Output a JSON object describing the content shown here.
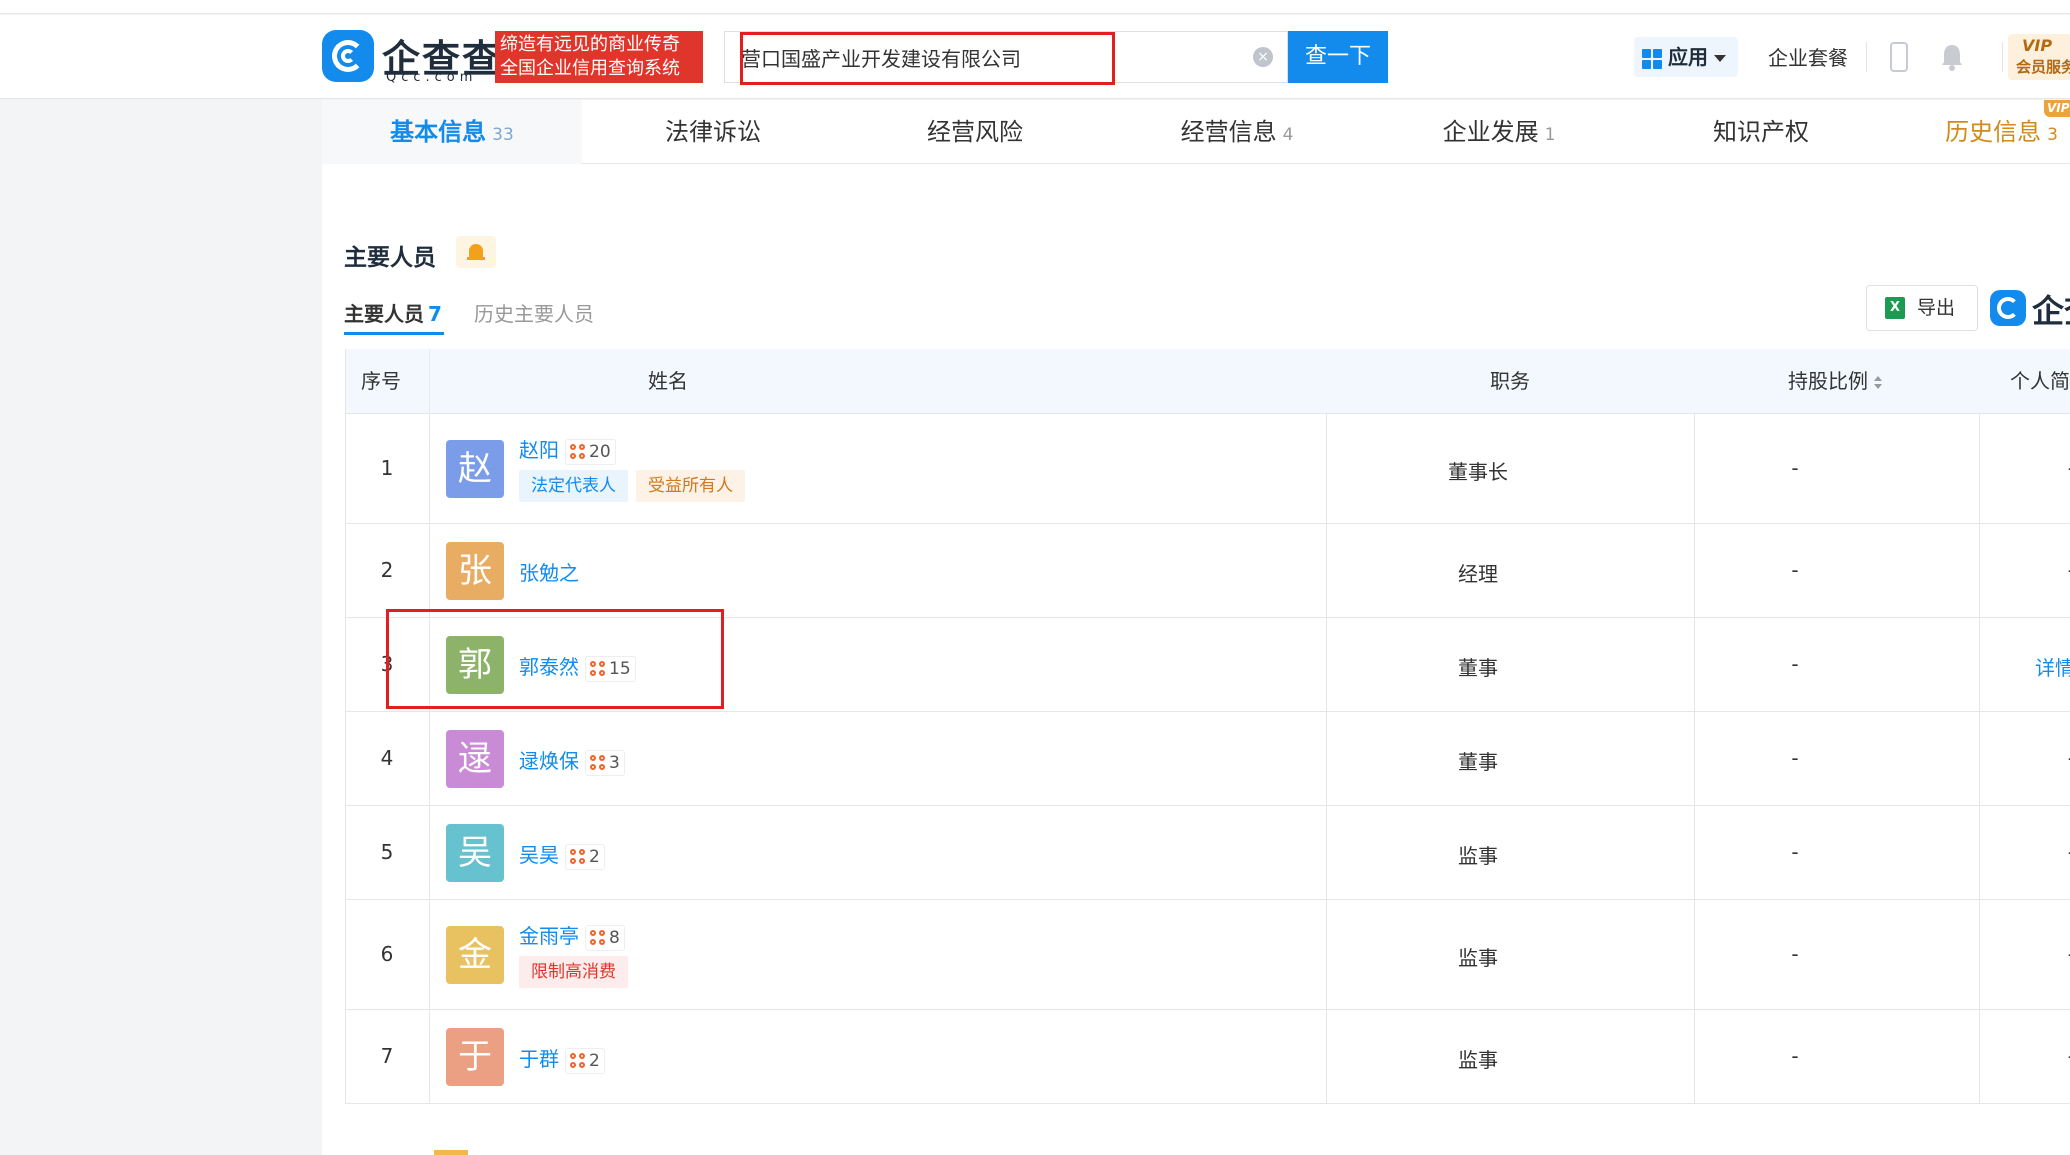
{
  "logo": {
    "name": "企查查",
    "sub": "Qcc.com",
    "slogan_line1": "缔造有远见的商业传奇",
    "slogan_line2": "全国企业信用查询系统"
  },
  "search": {
    "value": "营口国盛产业开发建设有限公司",
    "button": "查一下"
  },
  "topnav": {
    "apps": "应用",
    "suite": "企业套餐",
    "vip_line1": "VIP",
    "vip_line2": "会员服务"
  },
  "tabs": [
    {
      "label": "基本信息",
      "count": "33"
    },
    {
      "label": "法律诉讼",
      "count": ""
    },
    {
      "label": "经营风险",
      "count": ""
    },
    {
      "label": "经营信息",
      "count": "4"
    },
    {
      "label": "企业发展",
      "count": "1"
    },
    {
      "label": "知识产权",
      "count": ""
    },
    {
      "label": "历史信息",
      "count": "3"
    }
  ],
  "vip_tag": "VIP",
  "section": {
    "title": "主要人员",
    "subtab_main": "主要人员",
    "subtab_main_count": "7",
    "subtab_history": "历史主要人员",
    "export": "导出",
    "brand_text": "企查"
  },
  "table": {
    "headers": {
      "idx": "序号",
      "name": "姓名",
      "role": "职务",
      "share": "持股比例",
      "bio": "个人简"
    },
    "rows": [
      {
        "idx": "1",
        "avatar": "赵",
        "color": "#7b9de9",
        "name": "赵阳",
        "rel": "20",
        "tags": [
          "法定代表人",
          "受益所有人"
        ],
        "role": "董事长",
        "share": "-",
        "bio": "-"
      },
      {
        "idx": "2",
        "avatar": "张",
        "color": "#e8ad62",
        "name": "张勉之",
        "rel": "",
        "tags": [],
        "role": "经理",
        "share": "-",
        "bio": "-"
      },
      {
        "idx": "3",
        "avatar": "郭",
        "color": "#8db36b",
        "name": "郭泰然",
        "rel": "15",
        "tags": [],
        "role": "董事",
        "share": "-",
        "bio": "详情"
      },
      {
        "idx": "4",
        "avatar": "逯",
        "color": "#c98ad6",
        "name": "逯焕保",
        "rel": "3",
        "tags": [],
        "role": "董事",
        "share": "-",
        "bio": "-"
      },
      {
        "idx": "5",
        "avatar": "吴",
        "color": "#67c2cf",
        "name": "吴昊",
        "rel": "2",
        "tags": [],
        "role": "监事",
        "share": "-",
        "bio": "-"
      },
      {
        "idx": "6",
        "avatar": "金",
        "color": "#e8c161",
        "name": "金雨亭",
        "rel": "8",
        "tags": [
          "限制高消费"
        ],
        "role": "监事",
        "share": "-",
        "bio": "-"
      },
      {
        "idx": "7",
        "avatar": "于",
        "color": "#eb9f83",
        "name": "于群",
        "rel": "2",
        "tags": [],
        "role": "监事",
        "share": "-",
        "bio": "-"
      }
    ]
  }
}
